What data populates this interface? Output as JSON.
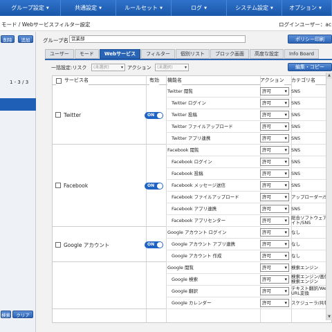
{
  "nav": {
    "items": [
      "グループ設定",
      "共通設定",
      "ルールセット",
      "ログ",
      "システム設定",
      "オプション"
    ]
  },
  "breadcrumb": "モード / Webサービスフィルター設定",
  "login": "ログインユーザー：ac",
  "sidebar": {
    "delete_label": "削除",
    "add_label": "追加",
    "pages": "1 - 3 / 3",
    "search_label": "検索",
    "clear_label": "クリア"
  },
  "group": {
    "label": "グループ名：",
    "value": "営業部",
    "print_label": "ポリシー印刷"
  },
  "tabs": [
    {
      "label": "ユーザー"
    },
    {
      "label": "モード"
    },
    {
      "label": "Webサービス",
      "active": true
    },
    {
      "label": "フィルター"
    },
    {
      "label": "個別リスト"
    },
    {
      "label": "ブロック画面"
    },
    {
      "label": "高度な設定"
    },
    {
      "label": "Info Board"
    }
  ],
  "bulk": {
    "label": "一括設定:リスク",
    "risk_placeholder": "(未選択)",
    "action_label": "アクション",
    "action_placeholder": "(未選択)",
    "copy_label": "編集・コピー"
  },
  "table": {
    "headers": {
      "service": "サービス名",
      "enabled": "有効",
      "function": "機能名",
      "action": "アクション",
      "category": "カテゴリ名"
    },
    "toggle_on": "ON",
    "groups": [
      {
        "service": "Twitter",
        "enabled": true,
        "rows": [
          {
            "name": "Twitter 閲覧",
            "action": "許可",
            "category": "SNS"
          },
          {
            "name": "Twitter ログイン",
            "action": "許可",
            "category": "SNS"
          },
          {
            "name": "Twitter 投稿",
            "action": "許可",
            "category": "SNS"
          },
          {
            "name": "Twitter ファイルアップロード",
            "action": "許可",
            "category": "SNS"
          },
          {
            "name": "Twitter アプリ連携",
            "action": "許可",
            "category": "SNS"
          }
        ]
      },
      {
        "service": "Facebook",
        "enabled": true,
        "rows": [
          {
            "name": "Facebook 閲覧",
            "action": "許可",
            "category": "SNS"
          },
          {
            "name": "Facebook ログイン",
            "action": "許可",
            "category": "SNS"
          },
          {
            "name": "Facebook 投稿",
            "action": "許可",
            "category": "SNS"
          },
          {
            "name": "Facebook メッセージ送信",
            "action": "許可",
            "category": "SNS"
          },
          {
            "name": "Facebook ファイルアップロード",
            "action": "許可",
            "category": "アップローダー/SN"
          },
          {
            "name": "Facebook アプリ連携",
            "action": "許可",
            "category": "SNS"
          },
          {
            "name": "Facebook アプリセンター",
            "action": "許可",
            "category": "総合ソフトウェアサイト/SNS"
          }
        ]
      },
      {
        "service": "Google アカウント",
        "enabled": true,
        "rows": [
          {
            "name": "Google アカウント ログイン",
            "action": "許可",
            "category": "なし"
          },
          {
            "name": "Google アカウント アプリ連携",
            "action": "許可",
            "category": "なし"
          },
          {
            "name": "Google アカウント 作成",
            "action": "許可",
            "category": "なし"
          }
        ]
      },
      {
        "service": "",
        "enabled": null,
        "rows": [
          {
            "name": "Google 閲覧",
            "action": "許可",
            "category": "検索エンジン"
          },
          {
            "name": "Google 検索",
            "action": "許可",
            "category": "検索エンジン/画像検索エンジン"
          },
          {
            "name": "Google 翻訳",
            "action": "許可",
            "category": "テキスト翻訳/Web URL変換"
          },
          {
            "name": "Google カレンダー",
            "action": "許可",
            "category": "スケジューラ/共有"
          }
        ]
      }
    ]
  }
}
